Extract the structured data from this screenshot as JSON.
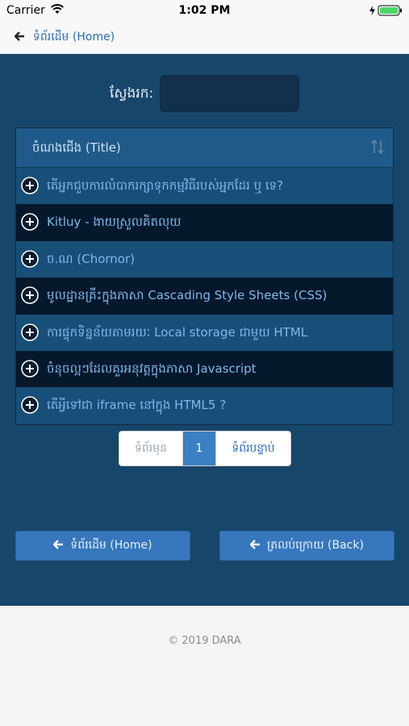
{
  "status_bar": {
    "carrier": "Carrier",
    "time": "1:02 PM"
  },
  "nav": {
    "back_label": "ទំព័រដើម (Home)"
  },
  "search": {
    "label": "ស្វែងរក:",
    "value": ""
  },
  "table": {
    "header": "ចំណងជើង (Title)",
    "rows": [
      "តើអ្នកជួបការលំបាករក្សាទុកកម្មវិធីរបស់អ្នកដែរ ឬ ទេ?",
      "Kitluy - ងាយស្រួលគិតលុយ",
      "ច.ណ (Chornor)",
      "មូលដ្ឋានគ្រឹះក្នុងភាសា Cascading Style Sheets (CSS)",
      "ការផ្ទុកទិន្នន័យតាមរយៈ Local storage ជាមួយ HTML",
      "ចំនុចល្អៗដែលគួរអនុវត្តក្នុងភាសា Javascript",
      "តើអ្វីទៅជា iframe នៅក្នុង HTML5 ?"
    ]
  },
  "pagination": {
    "prev_label": "ទំព័រមុន",
    "current": "1",
    "next_label": "ទំព័របន្ទាប់"
  },
  "buttons": {
    "home_label": "ទំព័រដើម (Home)",
    "back_label": "ត្រលប់ក្រោយ (Back)"
  },
  "footer": {
    "copyright": "© 2019 DARA"
  },
  "colors": {
    "main_bg": "#17466b",
    "accent": "#3677bd",
    "link": "#2a6ebb"
  },
  "icons": {
    "wifi": "wifi-icon",
    "battery": "battery-icon",
    "back": "arrow-left-icon",
    "sort": "sort-icon",
    "row": "plus-circle-icon"
  }
}
